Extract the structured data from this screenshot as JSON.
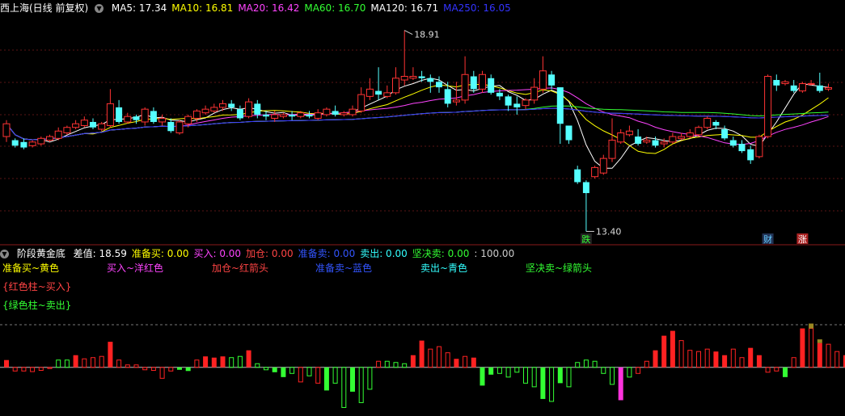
{
  "main": {
    "title": "西上海(日线 前复权)",
    "ma": [
      {
        "label": "MA5: 17.34",
        "color": "#ffffff"
      },
      {
        "label": "MA10: 16.81",
        "color": "#ffff00"
      },
      {
        "label": "MA20: 16.42",
        "color": "#ff44ff"
      },
      {
        "label": "MA60: 16.70",
        "color": "#33ff33"
      },
      {
        "label": "MA120: 16.71",
        "color": "#ffffff"
      },
      {
        "label": "MA250: 16.05",
        "color": "#3333ff"
      }
    ],
    "high_label": "18.91",
    "low_label": "13.40",
    "markers": [
      {
        "text": "跌",
        "color": "#33ff33",
        "bg": "#222222"
      },
      {
        "text": "财",
        "color": "#66ccff",
        "bg": "#223355"
      },
      {
        "text": "涨",
        "color": "#ffffff",
        "bg": "#aa2222"
      }
    ]
  },
  "indicator": {
    "title": "阶段黄金底",
    "values": [
      {
        "label": "差值: 18.59",
        "color": "#ffffff"
      },
      {
        "label": "准备买: 0.00",
        "color": "#ffff00"
      },
      {
        "label": "买入: 0.00",
        "color": "#ff44ff"
      },
      {
        "label": "加仓: 0.00",
        "color": "#ff4444"
      },
      {
        "label": "准备卖: 0.00",
        "color": "#3355ff"
      },
      {
        "label": "卖出: 0.00",
        "color": "#33ffff"
      },
      {
        "label": "坚决卖: 0.00",
        "color": "#33ff33"
      },
      {
        "label": ": 100.00",
        "color": "#cccccc"
      }
    ],
    "legend": [
      {
        "text": "准备买~黄色",
        "color": "#ffff00"
      },
      {
        "text": "买入~洋红色",
        "color": "#ff44ff"
      },
      {
        "text": "加仓~红箭头",
        "color": "#ff4444"
      },
      {
        "text": "准备卖~蓝色",
        "color": "#3355ff"
      },
      {
        "text": "卖出~青色",
        "color": "#33ffff"
      },
      {
        "text": "坚决卖~绿箭头",
        "color": "#33ff33"
      }
    ],
    "note1": {
      "text": "{红色柱~买入}",
      "color": "#ff4444"
    },
    "note2": {
      "text": "{绿色柱~卖出}",
      "color": "#33ff33"
    }
  },
  "chart_data": {
    "type": "candlestick",
    "price_range": [
      13.1,
      19.3
    ],
    "candles": [
      [
        16.0,
        16.35,
        16.45,
        15.85
      ],
      [
        15.9,
        15.75,
        15.95,
        15.7
      ],
      [
        15.85,
        15.7,
        15.95,
        15.65
      ],
      [
        15.75,
        15.85,
        15.9,
        15.7
      ],
      [
        15.8,
        15.95,
        16.0,
        15.75
      ],
      [
        15.9,
        16.0,
        16.05,
        15.85
      ],
      [
        15.95,
        16.15,
        16.25,
        15.9
      ],
      [
        16.1,
        16.25,
        16.3,
        16.05
      ],
      [
        16.25,
        16.35,
        16.45,
        16.2
      ],
      [
        16.3,
        16.45,
        16.55,
        16.25
      ],
      [
        16.4,
        16.25,
        16.5,
        16.2
      ],
      [
        16.2,
        16.35,
        16.4,
        16.15
      ],
      [
        16.3,
        16.9,
        17.3,
        16.25
      ],
      [
        16.8,
        16.4,
        17.0,
        16.35
      ],
      [
        16.4,
        16.55,
        16.65,
        16.35
      ],
      [
        16.55,
        16.45,
        16.6,
        16.35
      ],
      [
        16.4,
        16.75,
        16.8,
        16.3
      ],
      [
        16.7,
        16.4,
        16.8,
        16.35
      ],
      [
        16.4,
        16.5,
        16.6,
        16.3
      ],
      [
        16.4,
        16.15,
        16.5,
        16.1
      ],
      [
        16.1,
        16.4,
        16.45,
        16.05
      ],
      [
        16.35,
        16.55,
        16.6,
        16.25
      ],
      [
        16.5,
        16.7,
        16.75,
        16.4
      ],
      [
        16.65,
        16.75,
        16.85,
        16.6
      ],
      [
        16.7,
        16.8,
        16.9,
        16.65
      ],
      [
        16.8,
        16.9,
        17.0,
        16.7
      ],
      [
        16.9,
        16.8,
        17.0,
        16.7
      ],
      [
        16.75,
        16.5,
        16.85,
        16.45
      ],
      [
        16.55,
        16.95,
        17.05,
        16.5
      ],
      [
        16.9,
        16.6,
        17.0,
        16.5
      ],
      [
        16.6,
        16.55,
        16.7,
        16.45
      ],
      [
        16.5,
        16.6,
        16.7,
        16.4
      ],
      [
        16.55,
        16.6,
        16.65,
        16.5
      ],
      [
        16.6,
        16.55,
        16.7,
        16.45
      ],
      [
        16.55,
        16.65,
        16.7,
        16.5
      ],
      [
        16.6,
        16.55,
        16.7,
        16.5
      ],
      [
        16.5,
        16.65,
        16.75,
        16.45
      ],
      [
        16.6,
        16.75,
        16.8,
        16.55
      ],
      [
        16.7,
        16.6,
        16.85,
        16.55
      ],
      [
        16.6,
        16.65,
        16.7,
        16.55
      ],
      [
        16.6,
        16.75,
        16.85,
        16.55
      ],
      [
        16.7,
        17.15,
        17.35,
        16.65
      ],
      [
        17.1,
        17.3,
        17.6,
        17.0
      ],
      [
        17.25,
        17.15,
        17.9,
        17.0
      ],
      [
        17.1,
        17.2,
        17.4,
        17.05
      ],
      [
        17.2,
        17.6,
        17.9,
        17.15
      ],
      [
        17.55,
        17.65,
        18.91,
        17.4
      ],
      [
        17.6,
        17.65,
        17.9,
        17.55
      ],
      [
        17.65,
        17.6,
        17.8,
        17.5
      ],
      [
        17.6,
        17.5,
        17.7,
        17.2
      ],
      [
        17.5,
        17.35,
        17.65,
        17.2
      ],
      [
        17.3,
        16.9,
        17.5,
        16.8
      ],
      [
        16.95,
        17.0,
        17.5,
        16.85
      ],
      [
        17.0,
        17.7,
        18.2,
        16.9
      ],
      [
        17.65,
        17.3,
        17.8,
        17.2
      ],
      [
        17.3,
        17.7,
        17.8,
        17.2
      ],
      [
        17.6,
        17.2,
        17.7,
        17.15
      ],
      [
        17.2,
        17.1,
        17.3,
        17.0
      ],
      [
        17.1,
        16.85,
        17.15,
        16.7
      ],
      [
        16.9,
        16.8,
        17.1,
        16.6
      ],
      [
        16.85,
        17.0,
        17.05,
        16.75
      ],
      [
        17.0,
        17.35,
        17.6,
        16.9
      ],
      [
        17.3,
        17.8,
        18.2,
        17.2
      ],
      [
        17.7,
        17.4,
        17.8,
        17.3
      ],
      [
        17.35,
        16.35,
        17.35,
        15.8
      ],
      [
        16.3,
        15.9,
        16.3,
        15.8
      ],
      [
        15.1,
        14.75,
        15.2,
        14.7
      ],
      [
        14.75,
        14.45,
        14.8,
        13.4
      ],
      [
        14.9,
        15.15,
        15.2,
        14.85
      ],
      [
        15.0,
        15.4,
        15.5,
        14.95
      ],
      [
        15.4,
        15.9,
        16.5,
        15.3
      ],
      [
        15.85,
        16.1,
        16.2,
        15.8
      ],
      [
        16.05,
        16.15,
        16.3,
        16.0
      ],
      [
        16.0,
        15.8,
        16.2,
        15.75
      ],
      [
        15.85,
        15.9,
        16.0,
        15.8
      ],
      [
        15.9,
        15.75,
        16.0,
        15.7
      ],
      [
        15.8,
        15.85,
        15.95,
        15.7
      ],
      [
        15.85,
        16.0,
        16.1,
        15.8
      ],
      [
        15.95,
        16.0,
        16.1,
        15.9
      ],
      [
        16.0,
        16.1,
        16.2,
        15.95
      ],
      [
        16.05,
        16.25,
        16.3,
        16.0
      ],
      [
        16.25,
        16.5,
        16.55,
        16.2
      ],
      [
        16.4,
        16.3,
        16.45,
        16.2
      ],
      [
        16.2,
        15.95,
        16.3,
        15.9
      ],
      [
        15.9,
        15.75,
        16.0,
        15.7
      ],
      [
        15.8,
        15.6,
        15.9,
        15.55
      ],
      [
        15.65,
        15.35,
        15.75,
        15.25
      ],
      [
        15.45,
        16.0,
        16.05,
        15.4
      ],
      [
        16.0,
        17.65,
        17.7,
        15.95
      ],
      [
        17.55,
        17.4,
        17.7,
        17.25
      ],
      [
        17.45,
        17.5,
        17.55,
        17.4
      ],
      [
        17.4,
        17.25,
        17.55,
        17.2
      ],
      [
        17.25,
        17.45,
        17.5,
        17.2
      ],
      [
        17.45,
        17.45,
        17.55,
        17.4
      ],
      [
        17.4,
        17.25,
        17.75,
        17.2
      ],
      [
        17.3,
        17.34,
        17.45,
        17.25
      ]
    ],
    "indicator_bars": [
      [
        0.6,
        "rd"
      ],
      [
        -0.3,
        "ro"
      ],
      [
        -0.3,
        "ro"
      ],
      [
        -0.35,
        "ro"
      ],
      [
        -0.25,
        "ro"
      ],
      [
        -0.1,
        "ro"
      ],
      [
        0.6,
        "go"
      ],
      [
        0.6,
        "go"
      ],
      [
        1.0,
        "rs"
      ],
      [
        0.7,
        "ro"
      ],
      [
        0.8,
        "ro"
      ],
      [
        0.9,
        "ro"
      ],
      [
        2.1,
        "rs"
      ],
      [
        0.6,
        "ro"
      ],
      [
        0.2,
        "ro"
      ],
      [
        0.2,
        "ro"
      ],
      [
        -0.2,
        "ro"
      ],
      [
        -0.25,
        "ro"
      ],
      [
        -0.9,
        "ro"
      ],
      [
        -0.3,
        "ro"
      ],
      [
        -0.2,
        "gs"
      ],
      [
        -0.3,
        "gs"
      ],
      [
        0.6,
        "ro"
      ],
      [
        0.9,
        "rs"
      ],
      [
        0.8,
        "rs"
      ],
      [
        0.9,
        "rs"
      ],
      [
        0.8,
        "go"
      ],
      [
        0.9,
        "go"
      ],
      [
        1.4,
        "rs"
      ],
      [
        0.3,
        "go"
      ],
      [
        -0.2,
        "go"
      ],
      [
        -0.4,
        "gs"
      ],
      [
        -0.8,
        "gs"
      ],
      [
        -0.5,
        "go"
      ],
      [
        -1.2,
        "ro"
      ],
      [
        -0.7,
        "go"
      ],
      [
        -1.3,
        "ro"
      ],
      [
        -1.9,
        "gs"
      ],
      [
        -1.3,
        "go"
      ],
      [
        -3.3,
        "go"
      ],
      [
        -2.0,
        "gs"
      ],
      [
        -2.9,
        "go"
      ],
      [
        -1.8,
        "go"
      ],
      [
        0.5,
        "ro"
      ],
      [
        0.5,
        "go"
      ],
      [
        0.4,
        "go"
      ],
      [
        0.3,
        "go"
      ],
      [
        1.0,
        "rs"
      ],
      [
        2.2,
        "rs"
      ],
      [
        1.5,
        "ro"
      ],
      [
        1.7,
        "ro"
      ],
      [
        1.2,
        "ro"
      ],
      [
        0.7,
        "rs"
      ],
      [
        0.9,
        "ro"
      ],
      [
        0.8,
        "rs"
      ],
      [
        -1.5,
        "gs"
      ],
      [
        -0.6,
        "gs"
      ],
      [
        -0.5,
        "go"
      ],
      [
        -0.8,
        "go"
      ],
      [
        -0.4,
        "go"
      ],
      [
        -1.3,
        "go"
      ],
      [
        -1.6,
        "go"
      ],
      [
        -2.6,
        "gs"
      ],
      [
        -2.8,
        "go"
      ],
      [
        -1.3,
        "gs"
      ],
      [
        -1.6,
        "go"
      ],
      [
        0.4,
        "go"
      ],
      [
        0.6,
        "go"
      ],
      [
        0.5,
        "go"
      ],
      [
        -0.5,
        "go"
      ],
      [
        -1.4,
        "go"
      ],
      [
        -2.7,
        "mg"
      ],
      [
        -0.8,
        "go"
      ],
      [
        -0.5,
        "ro"
      ],
      [
        0.5,
        "ro"
      ],
      [
        1.4,
        "rs"
      ],
      [
        2.6,
        "rs"
      ],
      [
        3.0,
        "rs"
      ],
      [
        2.2,
        "ro"
      ],
      [
        1.4,
        "ro"
      ],
      [
        1.3,
        "ro"
      ],
      [
        1.5,
        "ro"
      ],
      [
        1.3,
        "rs"
      ],
      [
        1.0,
        "rs"
      ],
      [
        1.5,
        "ro"
      ],
      [
        0.8,
        "ro"
      ],
      [
        1.6,
        "rs"
      ],
      [
        1.0,
        "rs"
      ],
      [
        -0.4,
        "ro"
      ],
      [
        -0.3,
        "ro"
      ],
      [
        -0.8,
        "gs"
      ],
      [
        0.8,
        "ro"
      ],
      [
        3.2,
        "rs"
      ],
      [
        3.2,
        "ro"
      ],
      [
        2.0,
        "rs"
      ],
      [
        1.9,
        "ro"
      ],
      [
        1.3,
        "ro"
      ],
      [
        1.0,
        "rs"
      ],
      [
        1.1,
        "ro"
      ]
    ],
    "indicator_overflow": [
      [
        93,
        0.4
      ],
      [
        94,
        0.3
      ]
    ],
    "indicator_range": [
      -3.8,
      4.3
    ],
    "indicator_dashed_level": 3.5,
    "marker_positions": [
      67,
      88,
      92
    ],
    "high_index": 46,
    "low_index": 67
  }
}
